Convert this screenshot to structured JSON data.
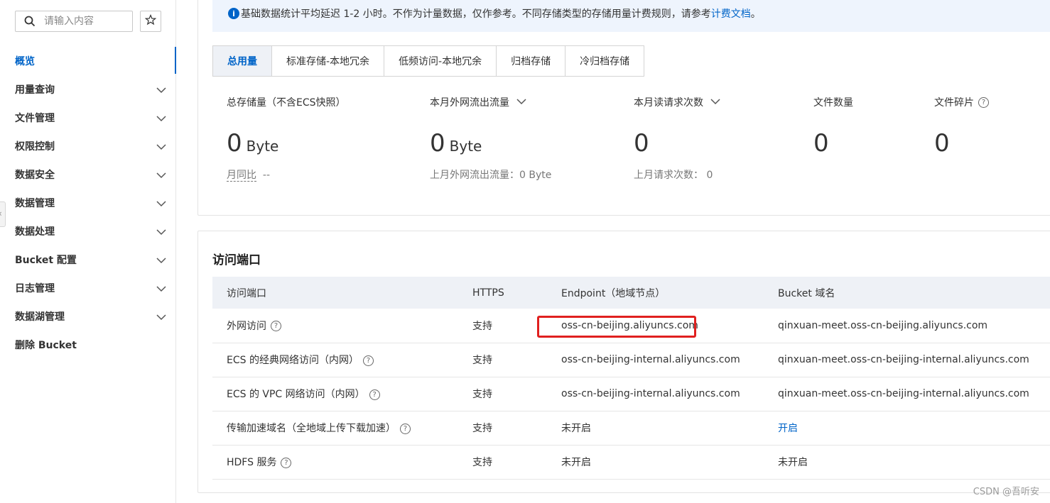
{
  "sidebar": {
    "search_placeholder": "请输入内容",
    "items": [
      {
        "label": "概览",
        "active": true,
        "expandable": false
      },
      {
        "label": "用量查询",
        "expandable": true
      },
      {
        "label": "文件管理",
        "expandable": true
      },
      {
        "label": "权限控制",
        "expandable": true
      },
      {
        "label": "数据安全",
        "expandable": true
      },
      {
        "label": "数据管理",
        "expandable": true
      },
      {
        "label": "数据处理",
        "expandable": true
      },
      {
        "label": "Bucket 配置",
        "expandable": true
      },
      {
        "label": "日志管理",
        "expandable": true
      },
      {
        "label": "数据湖管理",
        "expandable": true
      },
      {
        "label": "删除 Bucket",
        "expandable": false
      }
    ]
  },
  "notice": {
    "text": "基础数据统计平均延迟 1-2 小时。不作为计量数据，仅作参考。不同存储类型的存储用量计费规则，请参考",
    "link": "计费文档",
    "end": "。"
  },
  "tabs": [
    "总用量",
    "标准存储-本地冗余",
    "低频访问-本地冗余",
    "归档存储",
    "冷归档存储"
  ],
  "metrics": {
    "storage": {
      "label": "总存储量（不含ECS快照）",
      "value": "0",
      "unit": "Byte",
      "sub_label": "月同比",
      "sub_value": "--"
    },
    "traffic": {
      "label": "本月外网流出流量",
      "value": "0",
      "unit": "Byte",
      "sub": "上月外网流出流量：0 Byte"
    },
    "requests": {
      "label": "本月读请求次数",
      "value": "0",
      "sub": "上月请求次数：  0"
    },
    "files": {
      "label": "文件数量",
      "value": "0"
    },
    "fragments": {
      "label": "文件碎片",
      "value": "0"
    }
  },
  "endpoints": {
    "title": "访问端口",
    "headers": [
      "访问端口",
      "HTTPS",
      "Endpoint（地域节点）",
      "Bucket 域名"
    ],
    "rows": [
      {
        "name": "外网访问",
        "https": "支持",
        "endpoint": "oss-cn-beijing.aliyuncs.com",
        "domain": "qinxuan-meet.oss-cn-beijing.aliyuncs.com"
      },
      {
        "name": "ECS 的经典网络访问（内网）",
        "https": "支持",
        "endpoint": "oss-cn-beijing-internal.aliyuncs.com",
        "domain": "qinxuan-meet.oss-cn-beijing-internal.aliyuncs.com"
      },
      {
        "name": "ECS 的 VPC 网络访问（内网）",
        "https": "支持",
        "endpoint": "oss-cn-beijing-internal.aliyuncs.com",
        "domain": "qinxuan-meet.oss-cn-beijing-internal.aliyuncs.com"
      },
      {
        "name": "传输加速域名（全地域上传下载加速）",
        "https": "支持",
        "endpoint": "未开启",
        "domain": "开启"
      },
      {
        "name": "HDFS 服务",
        "https": "支持",
        "endpoint": "未开启",
        "domain": "未开启"
      }
    ]
  },
  "watermark": "CSDN @吾听安",
  "colors": {
    "accent": "#0064c8",
    "success": "#1e9a3c",
    "highlight": "#e0201f"
  },
  "icons": {
    "search": "search-icon",
    "star": "star-icon",
    "chevron": "chevron-down-icon",
    "help": "help-icon",
    "info": "info-icon"
  }
}
